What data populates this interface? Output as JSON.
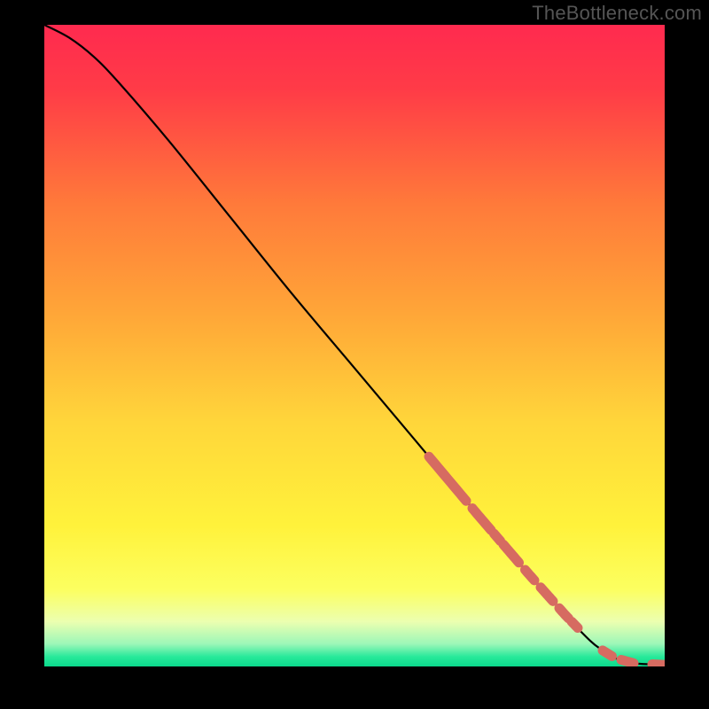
{
  "attribution": "TheBottleneck.com",
  "colors": {
    "background": "#000000",
    "gradient_stops": [
      {
        "offset": 0.0,
        "color": "#ff2a4f"
      },
      {
        "offset": 0.1,
        "color": "#ff3b47"
      },
      {
        "offset": 0.28,
        "color": "#ff7a3a"
      },
      {
        "offset": 0.45,
        "color": "#ffa638"
      },
      {
        "offset": 0.62,
        "color": "#ffd63a"
      },
      {
        "offset": 0.78,
        "color": "#fff23b"
      },
      {
        "offset": 0.88,
        "color": "#fcff60"
      },
      {
        "offset": 0.93,
        "color": "#ecffb0"
      },
      {
        "offset": 0.965,
        "color": "#9cf7b8"
      },
      {
        "offset": 0.985,
        "color": "#27e99a"
      },
      {
        "offset": 1.0,
        "color": "#0bd98c"
      }
    ],
    "curve": "#000000",
    "dash_marker": "#d66b61"
  },
  "chart_data": {
    "type": "line",
    "title": "",
    "xlabel": "",
    "ylabel": "",
    "xlim": [
      0,
      100
    ],
    "ylim": [
      0,
      100
    ],
    "series": [
      {
        "name": "curve",
        "x": [
          0,
          4,
          8,
          12,
          20,
          30,
          40,
          50,
          60,
          70,
          78,
          84,
          88,
          90,
          92,
          95,
          100
        ],
        "y": [
          100,
          98,
          95,
          91,
          82,
          70,
          58,
          46.5,
          35,
          23.5,
          14.5,
          8,
          4,
          2.5,
          1.3,
          0.5,
          0.25
        ]
      }
    ],
    "highlighted_dash_segments_x": [
      [
        62,
        68
      ],
      [
        69,
        72
      ],
      [
        72.5,
        73.5
      ],
      [
        74,
        76.5
      ],
      [
        77.5,
        79
      ],
      [
        80,
        82
      ],
      [
        83,
        84.5
      ],
      [
        85,
        86
      ],
      [
        90,
        91.5
      ],
      [
        93,
        95
      ],
      [
        98,
        100
      ]
    ]
  }
}
